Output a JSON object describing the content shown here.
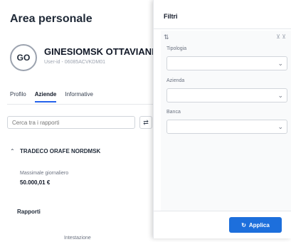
{
  "page": {
    "title": "Area personale"
  },
  "user": {
    "initials": "GO",
    "name": "GINESIOMSK OTTAVIANI",
    "user_id": "User-id - 06085ACVKDM01"
  },
  "tabs": [
    {
      "label": "Profilo",
      "active": false
    },
    {
      "label": "Aziende",
      "active": true
    },
    {
      "label": "Informative",
      "active": false
    }
  ],
  "search": {
    "placeholder": "Cerca tra i rapporti"
  },
  "company": {
    "name": "TRADECO ORAFE NORDMSK",
    "massimale_label": "Massimale giornaliero",
    "massimale_value": "50.000,01 €"
  },
  "rapporti": {
    "title": "Rapporti",
    "intestazione": "Intestazione"
  },
  "filters": {
    "title": "Filtri",
    "fields": [
      {
        "label": "Tipologia",
        "value": ""
      },
      {
        "label": "Azienda",
        "value": ""
      },
      {
        "label": "Banca",
        "value": ""
      }
    ],
    "apply_label": "Applica"
  },
  "colors": {
    "accent": "#1d6fdc"
  }
}
